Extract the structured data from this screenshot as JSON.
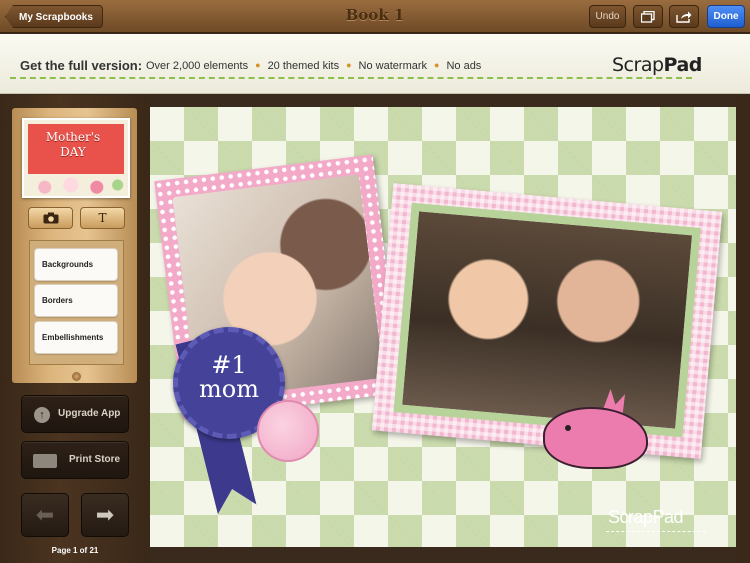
{
  "topbar": {
    "back_label": "My Scrapbooks",
    "title": "Book 1",
    "undo_label": "Undo",
    "done_label": "Done",
    "pages_icon": "pages-icon",
    "share_icon": "share-icon"
  },
  "promo": {
    "heading": "Get the full version:",
    "items": [
      "Over 2,000 elements",
      "20 themed kits",
      "No watermark",
      "No ads"
    ],
    "logo_light": "Scrap",
    "logo_bold": "Pad"
  },
  "sidebar": {
    "thumbnail_line1": "Mother's",
    "thumbnail_line2": "DAY",
    "photo_tool_icon": "camera-icon",
    "text_tool_label": "T",
    "menu": [
      "Backgrounds",
      "Borders",
      "Embellishments"
    ],
    "upgrade_label": "Upgrade App",
    "print_label": "Print Store",
    "prev_icon": "arrow-left-icon",
    "next_icon": "arrow-right-icon",
    "page_indicator": "Page 1 of 21"
  },
  "canvas": {
    "rosette_line1": "#1",
    "rosette_line2": "mom",
    "watermark": "ScrapPad"
  },
  "colors": {
    "accent": "#1e5fd0",
    "promo_dash": "#8cc04a",
    "frame_pink": "#f3a9c8",
    "rosette": "#454399"
  }
}
